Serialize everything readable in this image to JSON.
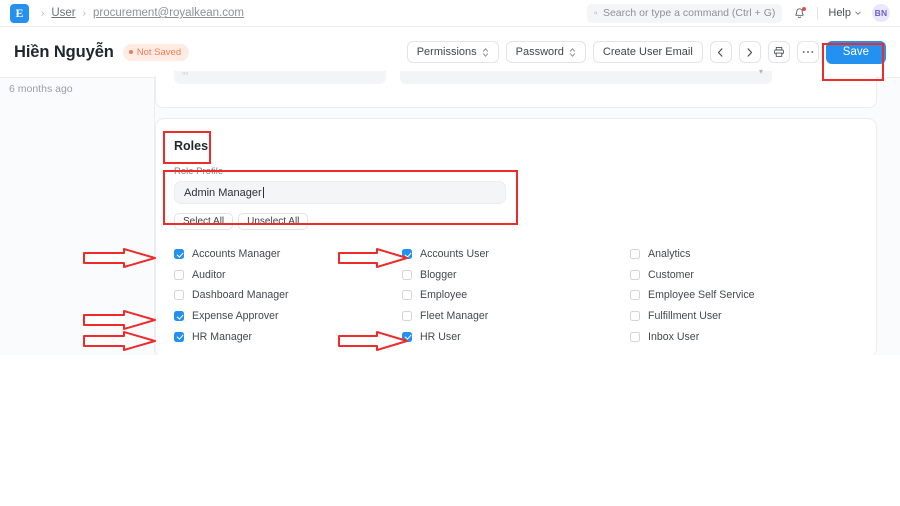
{
  "navbar": {
    "logo_letter": "E",
    "breadcrumbs": [
      {
        "label": "User"
      },
      {
        "label": "procurement@royalkean.com"
      }
    ],
    "separator": "›",
    "search": {
      "placeholder": "Search or type a command (Ctrl + G)",
      "value": "",
      "icon": "search-icon"
    },
    "notification_icon": "bell-icon",
    "help": {
      "label": "Help",
      "caret": "⌄"
    },
    "avatar_initials": "BN"
  },
  "pagehead": {
    "title": "Hiền Nguyễn",
    "status_badge": "Not Saved",
    "actions": {
      "permissions": "Permissions",
      "password": "Password",
      "create_user_email": "Create User Email",
      "prev": "‹",
      "next": "›",
      "print_icon": "printer-icon",
      "more": "···",
      "save": "Save"
    }
  },
  "sidebar": {
    "last_modified": "6 months ago"
  },
  "roles_card": {
    "section_title": "Roles",
    "role_profile": {
      "label": "Role Profile",
      "value": "Admin Manager",
      "placeholder": ""
    },
    "select_all": "Select All",
    "unselect_all": "Unselect All",
    "columns": [
      {
        "items": [
          {
            "label": "Accounts Manager",
            "checked": true
          },
          {
            "label": "Auditor",
            "checked": false
          },
          {
            "label": "Dashboard Manager",
            "checked": false
          },
          {
            "label": "Expense Approver",
            "checked": true
          },
          {
            "label": "HR Manager",
            "checked": true
          }
        ]
      },
      {
        "items": [
          {
            "label": "Accounts User",
            "checked": true
          },
          {
            "label": "Blogger",
            "checked": false
          },
          {
            "label": "Employee",
            "checked": false
          },
          {
            "label": "Fleet Manager",
            "checked": false
          },
          {
            "label": "HR User",
            "checked": true
          }
        ]
      },
      {
        "items": [
          {
            "label": "Analytics",
            "checked": false
          },
          {
            "label": "Customer",
            "checked": false
          },
          {
            "label": "Employee Self Service",
            "checked": false
          },
          {
            "label": "Fulfillment User",
            "checked": false
          },
          {
            "label": "Inbox User",
            "checked": false
          }
        ]
      }
    ]
  },
  "annotations": {
    "color": "#ee2b2b",
    "boxes": [
      {
        "name": "save-button-highlight"
      },
      {
        "name": "roles-title-highlight"
      },
      {
        "name": "role-profile-highlight"
      }
    ],
    "arrows": [
      {
        "name": "arrow-accounts-manager"
      },
      {
        "name": "arrow-expense-approver"
      },
      {
        "name": "arrow-hr-manager"
      },
      {
        "name": "arrow-accounts-user"
      },
      {
        "name": "arrow-hr-user"
      }
    ]
  },
  "colors": {
    "accent": "#2490ef",
    "annotation": "#ee2b2b",
    "warning": "#ef7e54",
    "page_bg": "#fafbfc"
  }
}
